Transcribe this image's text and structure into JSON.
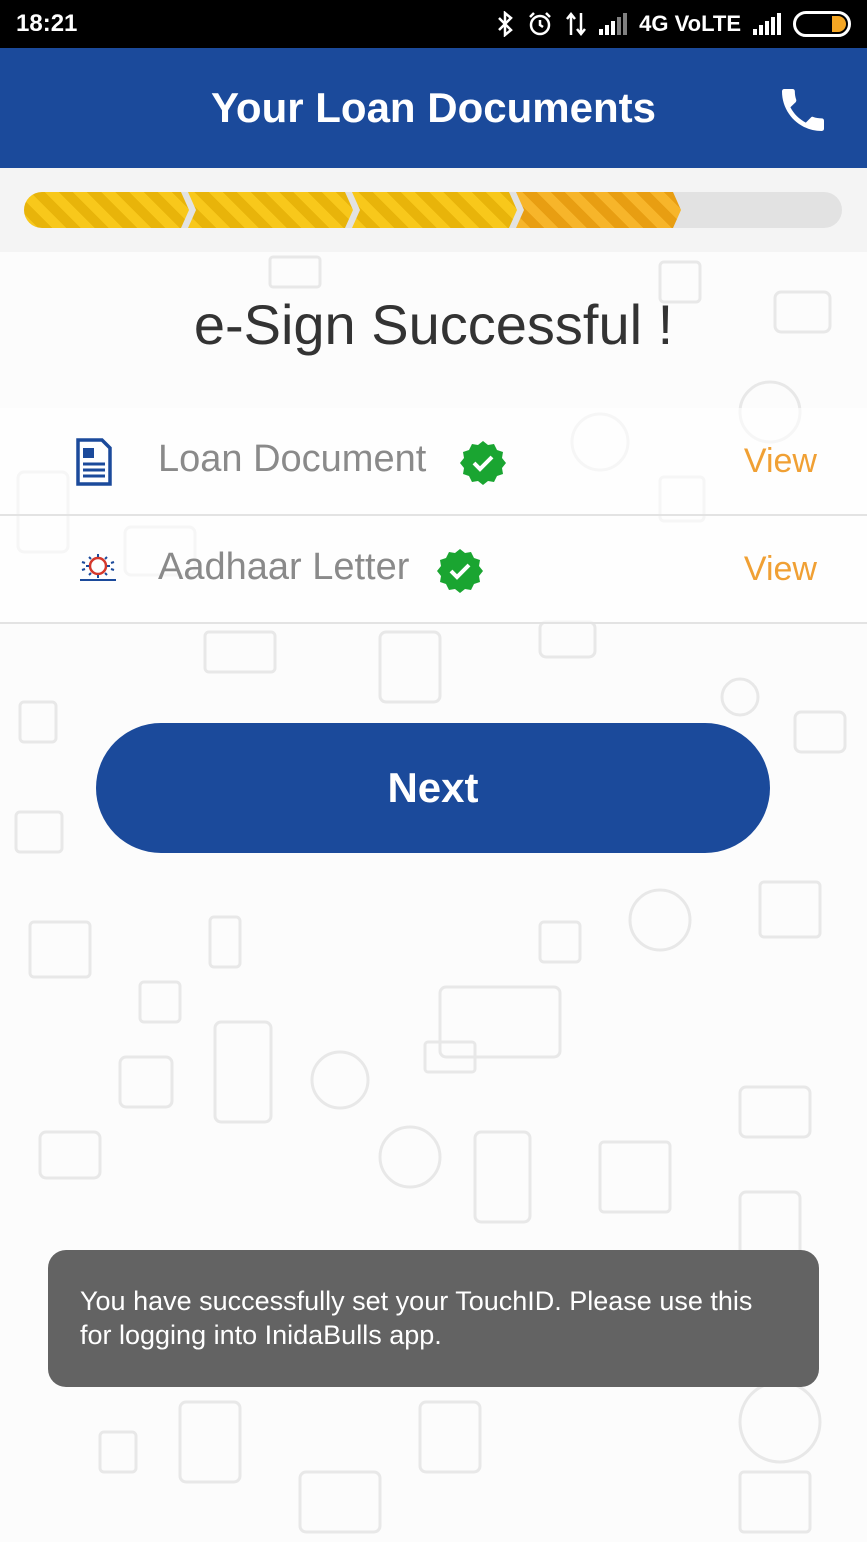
{
  "status_bar": {
    "time": "18:21",
    "network": "4G VoLTE",
    "battery_level": 0.15
  },
  "header": {
    "title": "Your Loan Documents",
    "phone_icon": "phone-icon",
    "bg_color": "#1b4a9b"
  },
  "progress": {
    "total_steps": 5,
    "completed_steps": 4
  },
  "main": {
    "heading": "e-Sign Successful !",
    "documents": [
      {
        "label": "Loan Document",
        "icon": "document-icon",
        "status": "verified",
        "action": "View"
      },
      {
        "label": "Aadhaar Letter",
        "icon": "aadhaar-logo-icon",
        "status": "verified",
        "action": "View"
      }
    ],
    "next_label": "Next"
  },
  "toast": {
    "message": "You have successfully set your TouchID. Please use this for logging into InidaBulls app."
  },
  "colors": {
    "accent": "#1b4a9b",
    "view_link": "#f0a034",
    "check": "#1aa531",
    "progress_yellow": "#f8c81b",
    "progress_orange": "#f7b52a"
  }
}
